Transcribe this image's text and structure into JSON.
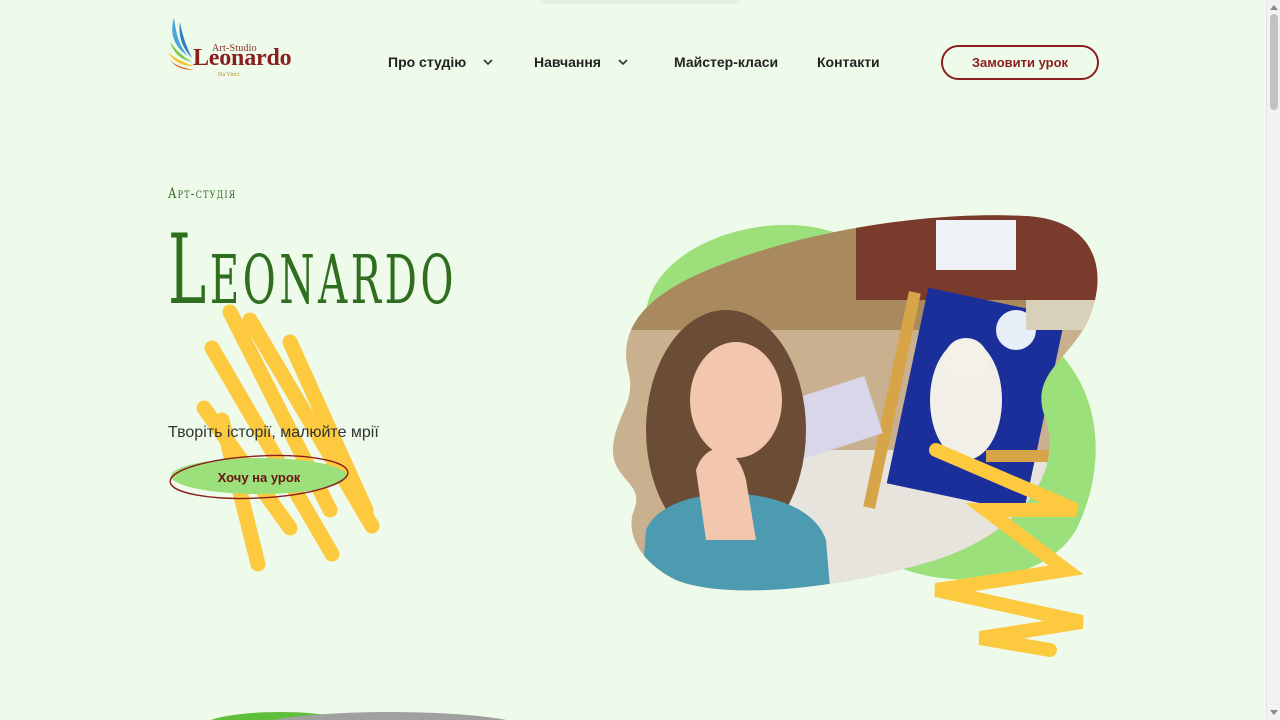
{
  "logo": {
    "small": "Art-Studio",
    "main": "Leonardo",
    "sub": "Da Vinci"
  },
  "nav": {
    "items": [
      {
        "label": "Про студію",
        "has_dropdown": true,
        "icon": "chevron-down-icon"
      },
      {
        "label": "Навчання",
        "has_dropdown": true,
        "icon": "chevron-down-icon"
      },
      {
        "label": "Майстер-класи",
        "has_dropdown": false
      },
      {
        "label": "Контакти",
        "has_dropdown": false
      }
    ],
    "cta_label": "Замовити урок"
  },
  "hero": {
    "eyebrow": "Арт-студія",
    "title": "Leonardo",
    "tagline": "Творіть історії, малюйте мрії",
    "cta_label": "Хочу на урок",
    "image_alt": "Дівчинка з картиною сови"
  },
  "colors": {
    "background": "#eefaea",
    "brand": "#8b1f1f",
    "title_green": "#2f6d1f",
    "blob_green": "#9be07a",
    "scribble_yellow": "#fcc93f"
  }
}
